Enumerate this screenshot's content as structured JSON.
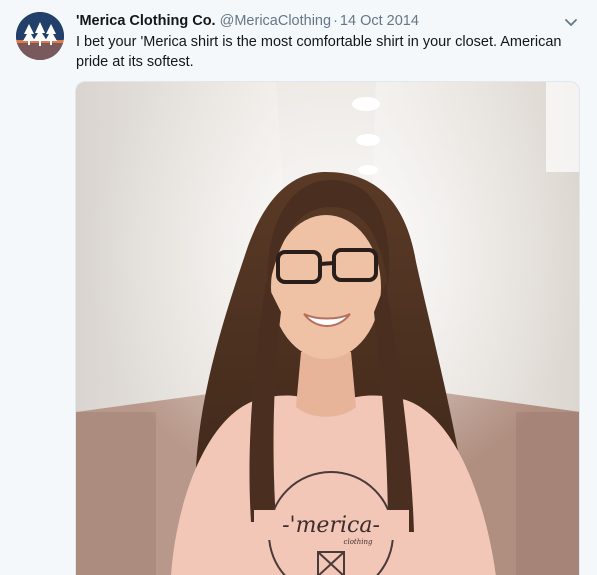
{
  "tweet": {
    "display_name": "'Merica Clothing Co.",
    "handle": "@MericaClothing",
    "separator": "·",
    "date": "14 Oct 2014",
    "text": "I bet your 'Merica shirt is the most comfortable shirt in your closet. American pride at its softest.",
    "menu_icon": "chevron-down-icon",
    "avatar_icon": "pine-trees-logo-icon",
    "photo_description_icon": "photo",
    "shirt_print": "-'merica-",
    "shirt_subprint": "clothing"
  },
  "colors": {
    "name": "#14171a",
    "meta": "#657786",
    "background": "#f5f8fa",
    "avatar_bg": "#1f3a5f"
  }
}
